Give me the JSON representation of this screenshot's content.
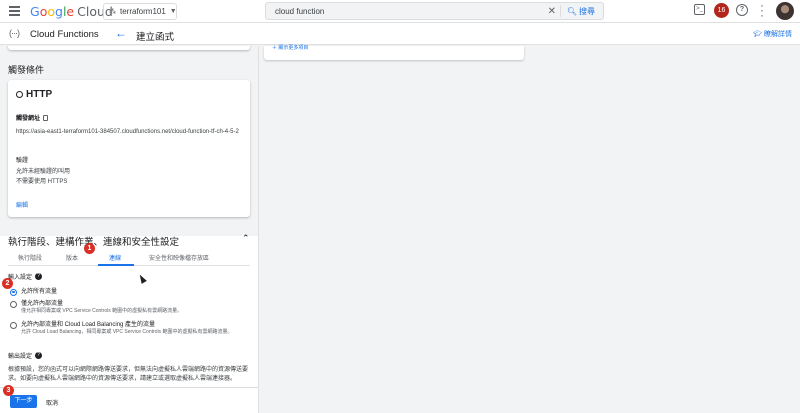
{
  "topbar": {
    "logo_g": "G",
    "logo_o1": "o",
    "logo_o2": "o",
    "logo_g2": "g",
    "logo_l": "l",
    "logo_e": "e",
    "logo_cloud": "Cloud",
    "project_name": "terraform101",
    "search_value": "cloud function",
    "search_button": "搜尋",
    "notifications_count": "16"
  },
  "subbar": {
    "service_title": "Cloud Functions",
    "page_title": "建立函式",
    "learn_link": "瞭解詳情"
  },
  "trigger": {
    "section_label": "觸發條件",
    "type": "HTTP",
    "url_label": "觸發網址",
    "url": "https://asia-east1-terraform101-384507.cloudfunctions.net/cloud-function-tf-ch-4-5-2",
    "auth_label": "驗證",
    "auth_line1": "允許未經驗證的叫用",
    "auth_line2": "不需要使用 HTTPS",
    "edit_label": "編輯"
  },
  "runtime": {
    "section_title": "執行階段、建構作業、連線和安全性設定",
    "tabs": [
      "執行階段",
      "版本",
      "連線",
      "安全性和映像檔存放區"
    ],
    "active_tab": "連線"
  },
  "ingress": {
    "label": "輸入設定",
    "options": [
      {
        "title": "允許所有流量",
        "desc": "",
        "selected": true
      },
      {
        "title": "僅允許內部流量",
        "desc": "僅允許相同專案或 VPC Service Controls 範圍中的虛擬私有雲網路流量。",
        "selected": false
      },
      {
        "title": "允許內部流量和 Cloud Load Balancing 產生的流量",
        "desc": "允許 Cloud Load Balancing，相同專案或 VPC Service Controls 範圍中的虛擬私有雲網路流量。",
        "selected": false
      }
    ]
  },
  "egress": {
    "label": "輸出設定",
    "desc": "根據預設，您的函式可以向網際網路傳送要求，但無法向虛擬私人雲端網路中的資源傳送要求。如要向虛擬私人雲端網路中的資源傳送要求，請建立或選取虛擬私人雲端連接器。"
  },
  "steps": [
    "1",
    "2",
    "3"
  ],
  "footer": {
    "next_label": "下一步",
    "cancel_label": "取消"
  },
  "right_pane": {
    "link": "＋ 顯示更多項目"
  }
}
